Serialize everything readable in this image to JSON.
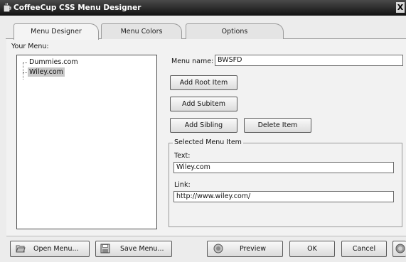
{
  "window": {
    "title": "CoffeeCup CSS Menu Designer",
    "close_glyph": "X"
  },
  "tabs": [
    {
      "label": "Menu Designer"
    },
    {
      "label": "Menu Colors"
    },
    {
      "label": "Options"
    }
  ],
  "your_menu_label": "Your Menu:",
  "tree": {
    "items": [
      {
        "label": "Dummies.com"
      },
      {
        "label": "Wiley.com",
        "selected": true
      }
    ]
  },
  "menu_name": {
    "label": "Menu name:",
    "value": "BWSFD"
  },
  "buttons": {
    "add_root": "Add Root Item",
    "add_subitem": "Add Subitem",
    "add_sibling": "Add Sibling",
    "delete_item": "Delete Item"
  },
  "selected_item": {
    "group_title": "Selected Menu Item",
    "text_label": "Text:",
    "text_value": "Wiley.com",
    "link_label": "Link:",
    "link_value": "http://www.wiley.com/"
  },
  "footer": {
    "open_menu": "Open Menu...",
    "save_menu": "Save Menu...",
    "preview": "Preview",
    "ok": "OK",
    "cancel": "Cancel"
  }
}
